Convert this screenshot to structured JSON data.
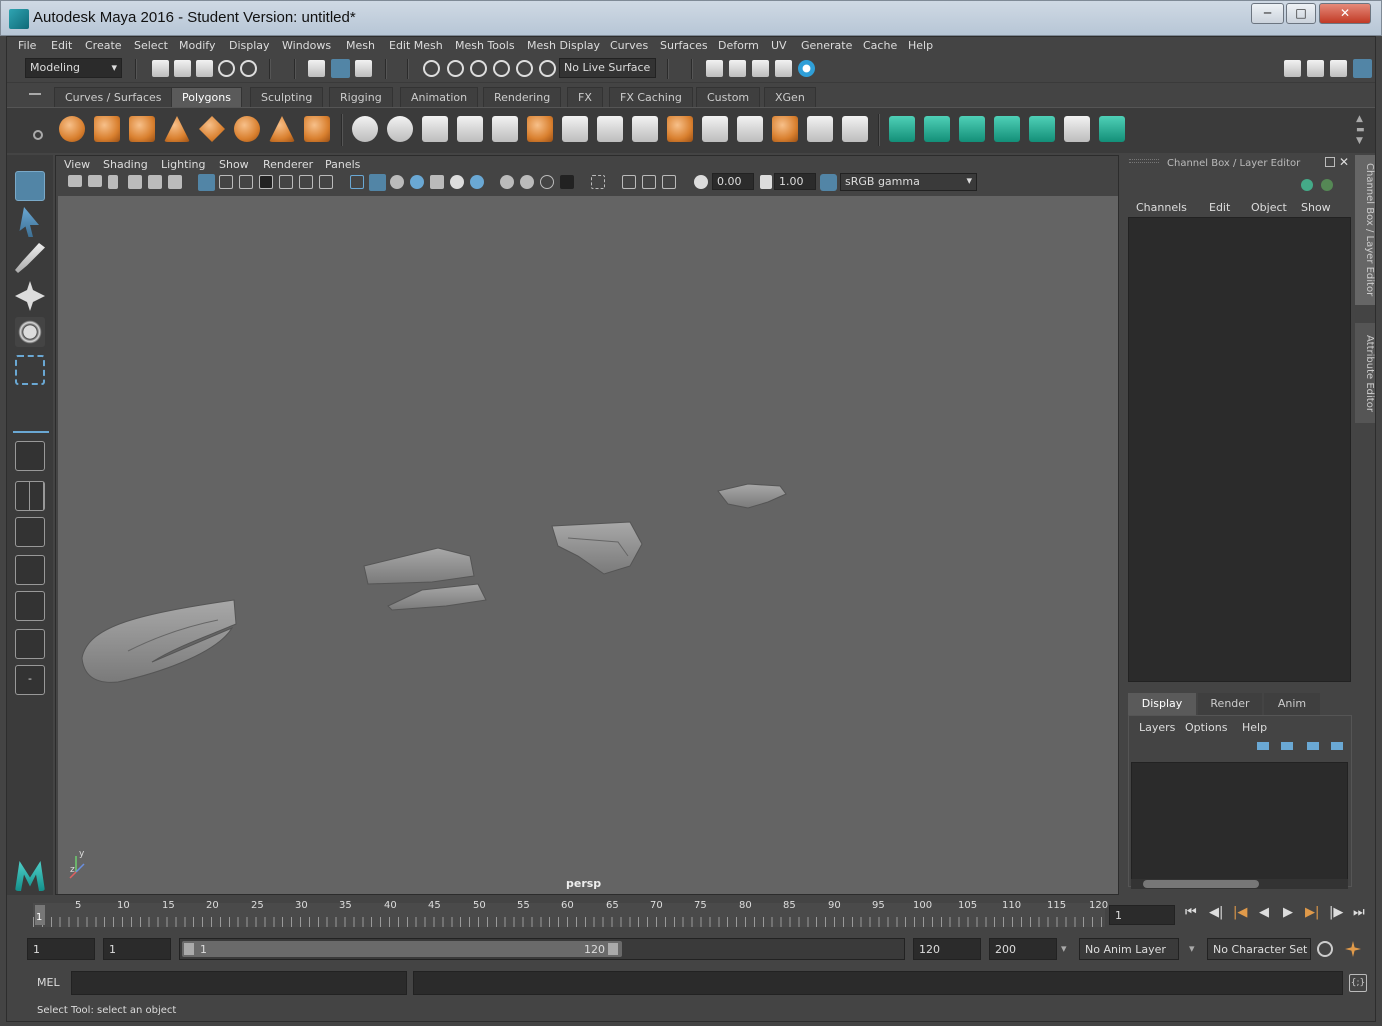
{
  "window": {
    "title": "Autodesk Maya 2016 - Student Version: untitled*"
  },
  "menubar": [
    "File",
    "Edit",
    "Create",
    "Select",
    "Modify",
    "Display",
    "Windows",
    "Mesh",
    "Edit Mesh",
    "Mesh Tools",
    "Mesh Display",
    "Curves",
    "Surfaces",
    "Deform",
    "UV",
    "Generate",
    "Cache",
    "Help"
  ],
  "statusline": {
    "mode": "Modeling",
    "live_surface": "No Live Surface"
  },
  "shelf_tabs": [
    "Curves / Surfaces",
    "Polygons",
    "Sculpting",
    "Rigging",
    "Animation",
    "Rendering",
    "FX",
    "FX Caching",
    "Custom",
    "XGen"
  ],
  "panel_menu": [
    "View",
    "Shading",
    "Lighting",
    "Show",
    "Renderer",
    "Panels"
  ],
  "panel_toolbar": {
    "exposure": "0.00",
    "gamma": "1.00",
    "color_space": "sRGB gamma"
  },
  "viewport": {
    "camera": "persp",
    "axis_y": "y",
    "axis_z": "z"
  },
  "channel_box": {
    "title": "Channel Box / Layer Editor",
    "menu": [
      "Channels",
      "Edit",
      "Object",
      "Show"
    ]
  },
  "layer_editor": {
    "tabs": [
      "Display",
      "Render",
      "Anim"
    ],
    "menu": [
      "Layers",
      "Options",
      "Help"
    ]
  },
  "side_tabs": [
    "Channel Box / Layer Editor",
    "Attribute Editor"
  ],
  "timeline": {
    "ticks": [
      "5",
      "10",
      "15",
      "20",
      "25",
      "30",
      "35",
      "40",
      "45",
      "50",
      "55",
      "60",
      "65",
      "70",
      "75",
      "80",
      "85",
      "90",
      "95",
      "100",
      "105",
      "110",
      "115",
      "120"
    ],
    "current_frame_marker": "1",
    "current_frame": "1"
  },
  "range": {
    "start_time": "1",
    "playback_start": "1",
    "slider_start": "1",
    "slider_end": "120",
    "playback_end": "120",
    "end_time": "200",
    "anim_layer": "No Anim Layer",
    "character_set": "No Character Set"
  },
  "command_line": {
    "language": "MEL"
  },
  "help_line": "Select Tool: select an object",
  "colors": {
    "accent": "#5285a6",
    "shelf_orange": "#d9802f",
    "shelf_green": "#1fa88d"
  }
}
